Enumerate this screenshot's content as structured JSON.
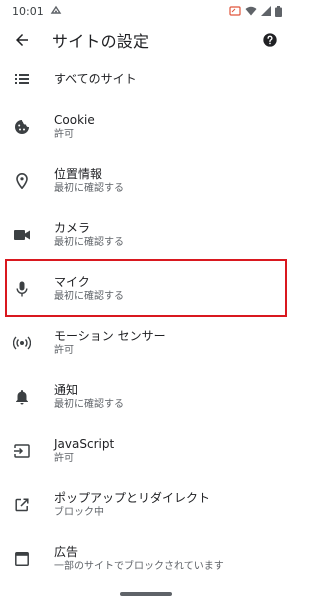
{
  "status_bar": {
    "time": "10:01"
  },
  "app_bar": {
    "title": "サイトの設定"
  },
  "items": [
    {
      "label": "すべてのサイト",
      "sub": ""
    },
    {
      "label": "Cookie",
      "sub": "許可"
    },
    {
      "label": "位置情報",
      "sub": "最初に確認する"
    },
    {
      "label": "カメラ",
      "sub": "最初に確認する"
    },
    {
      "label": "マイク",
      "sub": "最初に確認する"
    },
    {
      "label": "モーション センサー",
      "sub": "許可"
    },
    {
      "label": "通知",
      "sub": "最初に確認する"
    },
    {
      "label": "JavaScript",
      "sub": "許可"
    },
    {
      "label": "ポップアップとリダイレクト",
      "sub": "ブロック中"
    },
    {
      "label": "広告",
      "sub": "一部のサイトでブロックされています"
    }
  ],
  "icons": {
    "colors": {
      "icon": "#3c4043",
      "highlight": "#d9181f"
    }
  }
}
